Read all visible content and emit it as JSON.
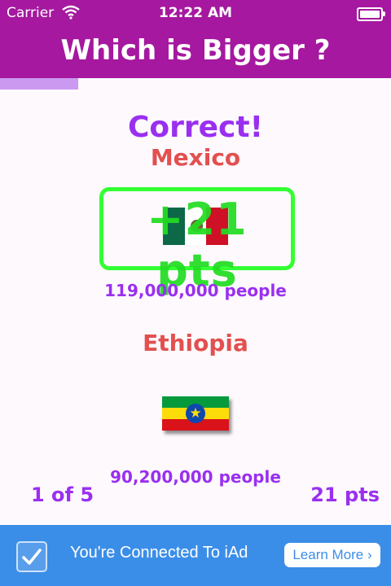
{
  "status_bar": {
    "carrier": "Carrier",
    "time": "12:22 AM"
  },
  "header": {
    "title": "Which is Bigger ?"
  },
  "progress": {
    "fraction": 0.2
  },
  "result": {
    "text": "Correct!",
    "points_awarded": "+21 pts"
  },
  "first": {
    "country": "Mexico",
    "population": "119,000,000 people",
    "flag": "mexico-flag"
  },
  "second": {
    "country": "Ethiopia",
    "population": "90,200,000 people",
    "flag": "ethiopia-flag"
  },
  "footer": {
    "question_counter": "1 of 5",
    "score": "21 pts"
  },
  "ad": {
    "message": "You're Connected To iAd",
    "button_label": "Learn More",
    "button_glyph": "›"
  },
  "colors": {
    "brand": "#a5189f",
    "accent_purple": "#9a2ff0",
    "country_red": "#e2504f",
    "success_green": "#33ff33",
    "ad_blue": "#3b8ee8"
  }
}
